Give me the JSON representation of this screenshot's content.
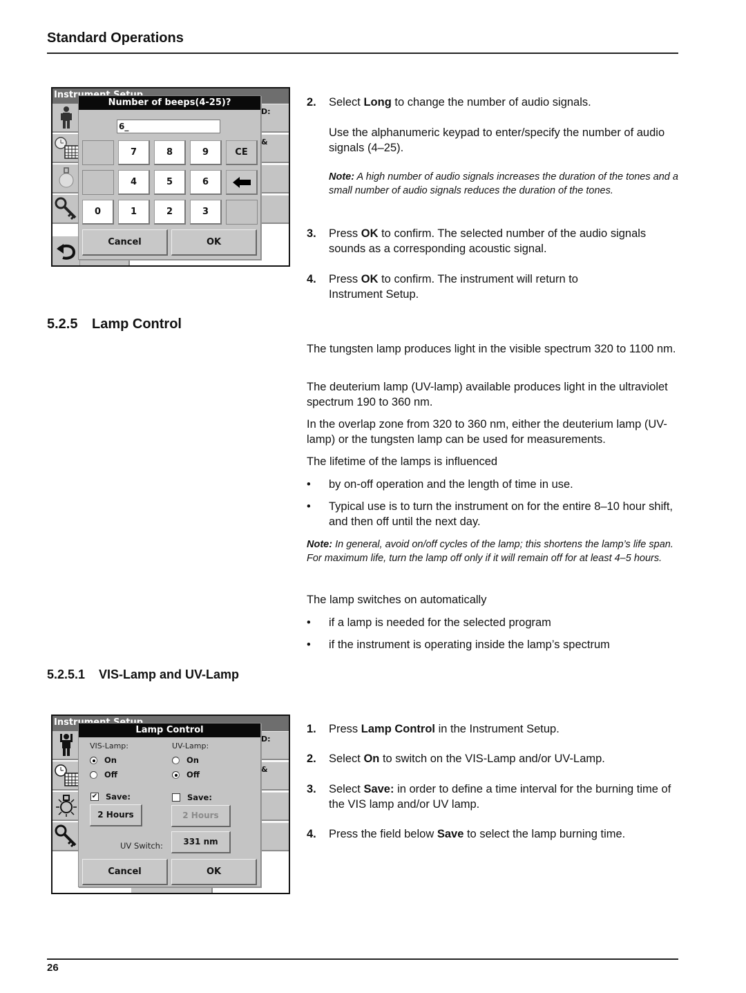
{
  "header": {
    "title": "Standard Operations"
  },
  "screen1": {
    "title": "Instrument Setup",
    "right_labels": [
      "D:",
      "&"
    ],
    "dialog_title": "Number of beeps(4-25)?",
    "input_value": "6_",
    "keys": [
      "7",
      "8",
      "9",
      "CE",
      "4",
      "5",
      "6",
      "0",
      "1",
      "2",
      "3"
    ],
    "cancel": "Cancel",
    "ok": "OK"
  },
  "steps_a": [
    {
      "num": "2.",
      "pre": "Select ",
      "bold": "Long",
      "post": " to change the number of audio signals."
    },
    {
      "text": "Use the alphanumeric keypad to enter/specify the number of audio signals (4–25)."
    },
    {
      "note_label": "Note:",
      "note_text": " A high number of audio signals increases the duration of the tones and a small number of audio signals reduces the duration of the tones."
    },
    {
      "num": "3.",
      "pre": "Press ",
      "bold": "OK",
      "post": " to confirm. The selected number of the audio signals sounds as a corresponding acoustic signal."
    },
    {
      "num": "4.",
      "pre": "Press ",
      "bold": "OK",
      "post": " to confirm. The instrument will return to Instrument Setup."
    }
  ],
  "section": {
    "num": "5.2.5",
    "title": "Lamp Control"
  },
  "lamp_paras": [
    "The tungsten lamp produces light in the visible spectrum 320 to 1100 nm.",
    "The deuterium lamp (UV-lamp) available produces light in the ultraviolet spectrum 190 to 360 nm.",
    "In the overlap zone from 320 to 360 nm, either the deuterium lamp (UV-lamp) or the tungsten lamp can be used for measurements.",
    "The lifetime of the lamps is influenced"
  ],
  "lifetime_bullets": [
    "by on-off operation and the length of time in use.",
    "Typical use is to turn the instrument on for the entire 8–10 hour shift, and then off until the next day."
  ],
  "lamp_note": {
    "label": "Note:",
    "text": " In general, avoid on/off cycles of the lamp; this shortens the lamp’s life span. For maximum life, turn the lamp off only if it will remain off for at least 4–5 hours."
  },
  "auto_para": "The lamp switches on automatically",
  "auto_bullets": [
    "if a lamp is needed for the selected program",
    "if the instrument is operating inside the lamp’s spectrum"
  ],
  "subsection": {
    "num": "5.2.5.1",
    "title": "VIS-Lamp and UV-Lamp"
  },
  "screen2": {
    "title": "Instrument Setup",
    "right_labels": [
      "D:",
      "&"
    ],
    "dialog_title": "Lamp Control",
    "vis_label": "VIS-Lamp:",
    "uv_label": "UV-Lamp:",
    "on": "On",
    "off": "Off",
    "vis_state": "On",
    "uv_state": "Off",
    "save": "Save:",
    "vis_save_checked": true,
    "uv_save_checked": false,
    "vis_hours": "2 Hours",
    "uv_hours": "2 Hours",
    "uv_switch_label": "UV Switch:",
    "uv_switch_value": "331 nm",
    "cancel": "Cancel",
    "ok": "OK"
  },
  "steps_b": [
    {
      "num": "1.",
      "pre": "Press ",
      "bold": "Lamp Control",
      "post": " in the Instrument Setup."
    },
    {
      "num": "2.",
      "pre": "Select ",
      "bold": "On",
      "post": " to switch on the VIS-Lamp and/or UV-Lamp."
    },
    {
      "num": "3.",
      "pre": "Select ",
      "bold": "Save:",
      "post": " in order to define a time interval for the burning time of the VIS lamp and/or UV lamp."
    },
    {
      "num": "4.",
      "pre": "Press the field below ",
      "bold": "Save",
      "post": " to select the lamp burning time."
    }
  ],
  "footer": {
    "page_number": "26"
  }
}
